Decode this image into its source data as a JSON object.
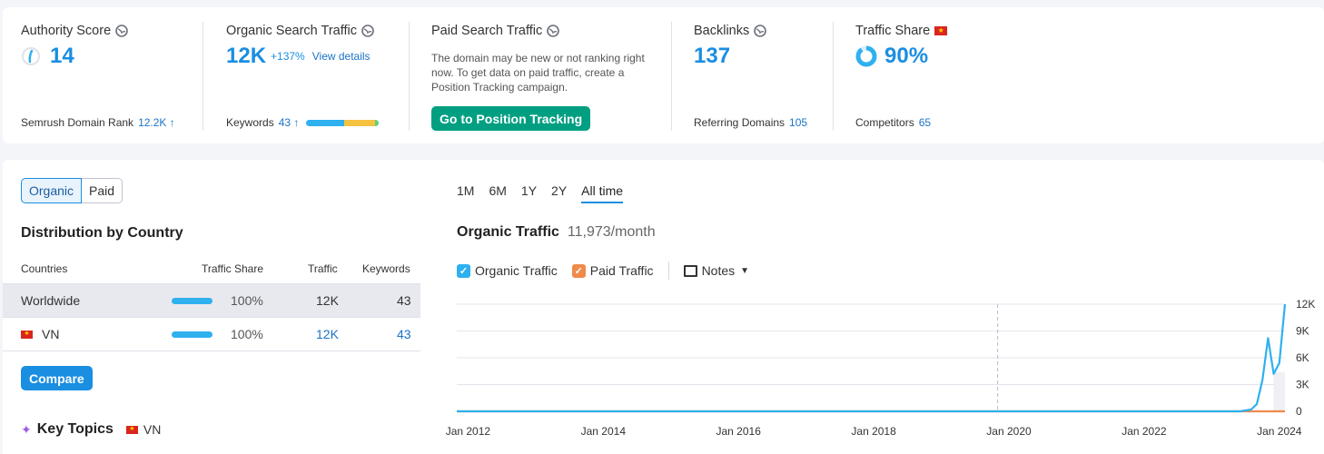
{
  "metrics": {
    "authority": {
      "title": "Authority Score",
      "value": "14",
      "sub_label": "Semrush Domain Rank",
      "sub_value": "12.2K ↑"
    },
    "organic": {
      "title": "Organic Search Traffic",
      "value": "12K",
      "growth": "+137%",
      "link": "View details",
      "sub_label": "Keywords",
      "sub_value": "43 ↑"
    },
    "paid": {
      "title": "Paid Search Traffic",
      "description": "The domain may be new or not ranking right now. To get data on paid traffic, create a Position Tracking campaign.",
      "button": "Go to Position Tracking"
    },
    "backlinks": {
      "title": "Backlinks",
      "value": "137",
      "sub_label": "Referring Domains",
      "sub_value": "105"
    },
    "traffic_share": {
      "title": "Traffic Share",
      "value": "90%",
      "sub_label": "Competitors",
      "sub_value": "65",
      "share_fraction": 0.9
    }
  },
  "toggle": {
    "organic": "Organic",
    "paid": "Paid"
  },
  "distribution": {
    "title": "Distribution by Country",
    "headers": {
      "countries": "Countries",
      "share": "Traffic Share",
      "traffic": "Traffic",
      "keywords": "Keywords"
    },
    "rows": [
      {
        "country": "Worldwide",
        "share": "100%",
        "traffic": "12K",
        "keywords": "43"
      },
      {
        "country": "VN",
        "share": "100%",
        "traffic": "12K",
        "keywords": "43"
      }
    ]
  },
  "compare_button": "Compare",
  "key_topics": {
    "title": "Key Topics",
    "country": "VN"
  },
  "period_tabs": [
    "1M",
    "6M",
    "1Y",
    "2Y",
    "All time"
  ],
  "chart_header": {
    "title": "Organic Traffic",
    "value": "11,973/month"
  },
  "legend": {
    "organic": "Organic Traffic",
    "paid": "Paid Traffic",
    "notes": "Notes"
  },
  "colors": {
    "accent": "#1a8ee1",
    "green": "#009f81",
    "organic": "#2fb0ef",
    "paid": "#f08a4b",
    "flag": "#da251d"
  },
  "chart_data": {
    "type": "line",
    "x_ticks": [
      "Jan 2012",
      "Jan 2014",
      "Jan 2016",
      "Jan 2018",
      "Jan 2020",
      "Jan 2022",
      "Jan 2024"
    ],
    "y_ticks": [
      "12K",
      "9K",
      "6K",
      "3K",
      "0"
    ],
    "ylim": [
      0,
      12000
    ],
    "xlim": [
      "2011-11",
      "2024-02"
    ],
    "grid": true,
    "series": [
      {
        "name": "Organic Traffic",
        "color": "#2fb0ef",
        "points": [
          [
            "2011-11",
            0
          ],
          [
            "2015-01",
            0
          ],
          [
            "2019-01",
            0
          ],
          [
            "2023-06",
            0
          ],
          [
            "2023-08",
            200
          ],
          [
            "2023-09",
            800
          ],
          [
            "2023-10",
            3500
          ],
          [
            "2023-11",
            8200
          ],
          [
            "2023-12",
            4200
          ],
          [
            "2024-01",
            5400
          ],
          [
            "2024-02",
            12000
          ]
        ]
      },
      {
        "name": "Paid Traffic",
        "color": "#f08a4b",
        "points": [
          [
            "2011-11",
            0
          ],
          [
            "2024-02",
            0
          ]
        ]
      }
    ],
    "marker_date": "2019-11"
  }
}
